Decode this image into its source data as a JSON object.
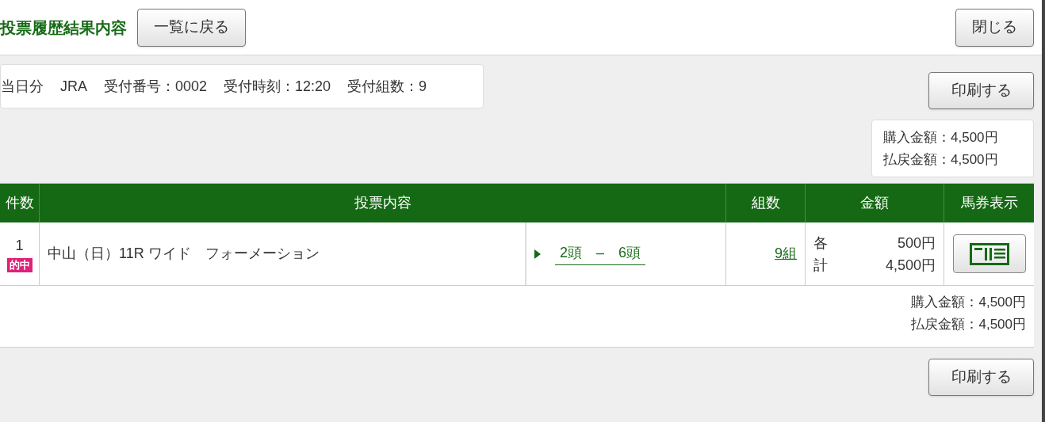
{
  "title": "投票履歴結果内容",
  "back_button": "一覧に戻る",
  "close_button": "閉じる",
  "info": [
    "当日分",
    "JRA",
    "受付番号：0002",
    "受付時刻：12:20",
    "受付組数：9"
  ],
  "print_button_top": "印刷する",
  "summary_top": [
    "購入金額：4,500円",
    "払戻金額：4,500円"
  ],
  "table": {
    "columns": [
      "件数",
      "投票内容",
      "組数",
      "金額",
      "馬券表示"
    ],
    "rows": [
      {
        "count": "1",
        "badge": "的中",
        "content": "中山（日）11R ワイド　フォーメーション",
        "selection": "2頭　–　6頭",
        "combos": "9組",
        "amounts": [
          {
            "label": "各",
            "value": "500円"
          },
          {
            "label": "計",
            "value": "4,500円"
          }
        ]
      }
    ],
    "summary": [
      "購入金額：4,500円",
      "払戻金額：4,500円"
    ]
  },
  "print_button_bottom": "印刷する"
}
